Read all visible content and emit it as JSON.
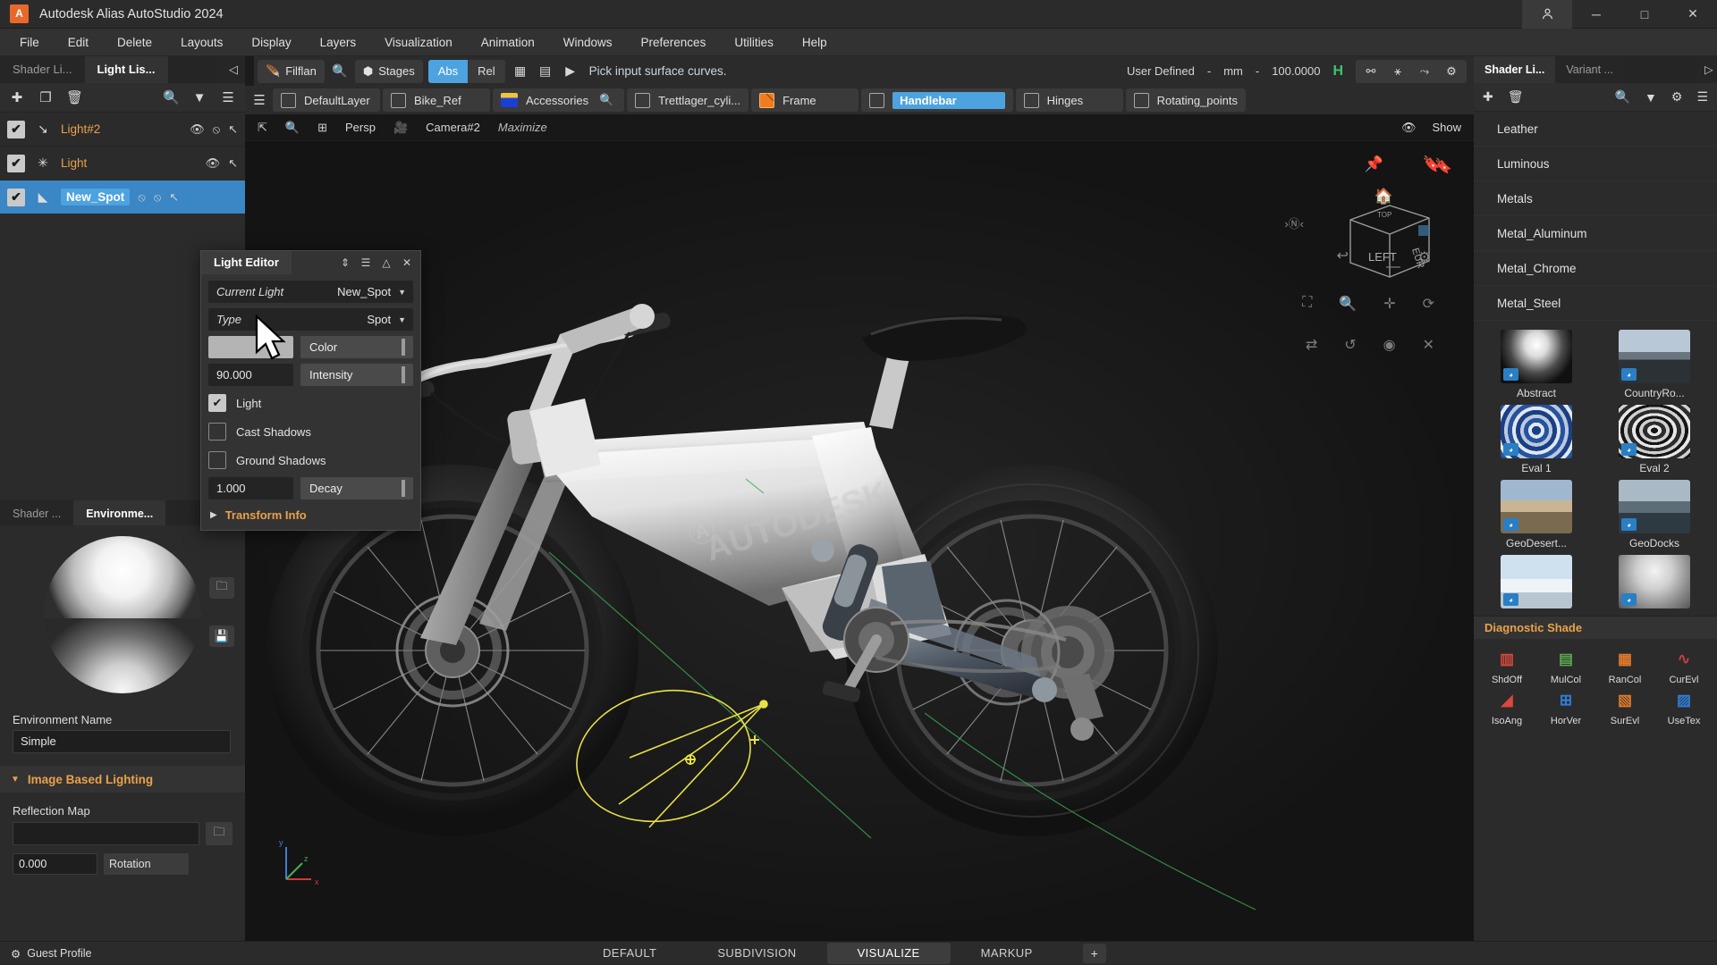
{
  "titlebar": {
    "logo": "A",
    "title": "Autodesk Alias AutoStudio 2024",
    "account_icon": "person-icon",
    "minimize": "─",
    "maximize": "□",
    "close": "✕"
  },
  "menubar": {
    "items": [
      "File",
      "Edit",
      "Delete",
      "Layouts",
      "Display",
      "Layers",
      "Visualization",
      "Animation",
      "Windows",
      "Preferences",
      "Utilities",
      "Help"
    ]
  },
  "left_panel": {
    "tabs": [
      {
        "label": "Shader Li...",
        "active": false
      },
      {
        "label": "Light Lis...",
        "active": true
      }
    ],
    "collapse_icon": "◁",
    "toolbar": [
      "add-icon",
      "duplicate-icon",
      "delete-icon",
      "search-icon",
      "filter-icon",
      "menu-icon"
    ],
    "lights": [
      {
        "name": "Light#2",
        "type_icon": "directional-light-icon",
        "checked": true,
        "selected": false,
        "actions": [
          "eye-icon",
          "eye-off-icon",
          "pointer-icon"
        ]
      },
      {
        "name": "Light",
        "type_icon": "point-light-icon",
        "checked": true,
        "selected": false,
        "actions": [
          "eye-icon",
          "pointer-icon"
        ]
      },
      {
        "name": "New_Spot",
        "type_icon": "spot-light-icon",
        "checked": true,
        "selected": true,
        "actions": [
          "eye-off-icon",
          "eye-off-icon",
          "pointer-icon"
        ]
      }
    ]
  },
  "environment_panel": {
    "tabs": [
      {
        "label": "Shader ...",
        "active": false
      },
      {
        "label": "Environme...",
        "active": true
      }
    ],
    "name_label": "Environment Name",
    "name_value": "Simple",
    "section_title": "Image Based Lighting",
    "reflection_label": "Reflection Map",
    "reflection_value": "",
    "rotation_value": "0.000",
    "rotation_label": "Rotation",
    "browse_icon": "folder-icon",
    "save_icon": "save-icon",
    "open_icon": "folder-open-icon"
  },
  "promptbar": {
    "collapse_icon": "◁",
    "tool_name": "Filflan",
    "search_icon": "search-icon",
    "stages_label": "Stages",
    "stages_icon": "cube-icon",
    "abs_label": "Abs",
    "rel_label": "Rel",
    "abs_active": true,
    "grid_icon": "grid-icon",
    "list_icon": "list-icon",
    "play_icon": "▶",
    "prompt": "Pick input surface curves.",
    "coord_system": "User Defined",
    "dash": "-",
    "unit": "mm",
    "grid_value": "100.0000",
    "h_flag": "H",
    "unit_icons": [
      "construction-plane-icon",
      "snap-grid-icon",
      "snap-curve-icon",
      "settings-gear-icon"
    ]
  },
  "layerbar": {
    "menu_icon": "hamburger-icon",
    "layers": [
      {
        "name": "DefaultLayer",
        "swatch": "empty",
        "highlight": false
      },
      {
        "name": "Bike_Ref",
        "swatch": "empty",
        "highlight": false
      },
      {
        "name": "Accessories",
        "swatch": "folder",
        "highlight": false,
        "search_icon": "layer-search-icon"
      },
      {
        "name": "Trettlager_cyli...",
        "swatch": "empty",
        "highlight": false
      },
      {
        "name": "Frame",
        "swatch": "orange",
        "highlight": false
      },
      {
        "name": "Handlebar",
        "swatch": "empty",
        "highlight": true
      },
      {
        "name": "Hinges",
        "swatch": "empty",
        "highlight": false
      },
      {
        "name": "Rotating_points",
        "swatch": "empty",
        "highlight": false
      }
    ]
  },
  "viewport": {
    "header": {
      "expand_icon": "expand-icon",
      "zoom_icon": "magnifier-icon",
      "layout_icon": "layout-grid-icon",
      "view_name": "Persp",
      "camera_icon": "camera-icon",
      "camera_name": "Camera#2",
      "maximize_label": "Maximize",
      "eye_icon": "eye-icon",
      "show_label": "Show"
    },
    "hud_icons": [
      [
        "pin-icon",
        "bookmark-icon"
      ],
      [
        "home-icon"
      ],
      [
        "compass-n-icon",
        "view-cube-left",
        "settings-gear-icon"
      ],
      [
        "undo-arrow-icon",
        "minus-icon"
      ],
      [
        "zoom-fit-icon",
        "magnifier-icon",
        "pan-icon",
        "orbit-icon"
      ],
      [
        "mirror-icon",
        "rotate-icon",
        "target-icon",
        "close-x-icon"
      ]
    ],
    "navcube_faces": {
      "top": "TOP",
      "front": "LEFT",
      "right": "EUR"
    },
    "axis_labels": {
      "x": "x",
      "y": "y",
      "z": "z"
    },
    "watermark": "AUTODESK"
  },
  "light_editor": {
    "title": "Light Editor",
    "titlebar_icons": [
      "resize-icon",
      "menu-icon",
      "collapse-icon",
      "close-icon"
    ],
    "rows": [
      {
        "key": "Current Light",
        "value": "New_Spot"
      },
      {
        "key": "Type",
        "value": "Spot"
      }
    ],
    "color_swatch": "#b4b4b4",
    "color_label": "Color",
    "intensity_value": "90.000",
    "intensity_label": "Intensity",
    "checkboxes": [
      {
        "label": "Light",
        "checked": true
      },
      {
        "label": "Cast Shadows",
        "checked": false
      },
      {
        "label": "Ground Shadows",
        "checked": false
      }
    ],
    "decay_value": "1.000",
    "decay_label": "Decay",
    "transform_label": "Transform Info",
    "transform_caret": "▶"
  },
  "right_panel": {
    "tabs": [
      {
        "label": "Shader Li...",
        "active": true
      },
      {
        "label": "Variant ...",
        "active": false
      }
    ],
    "arrow_icon": "▷",
    "toolbar": [
      "add-icon",
      "delete-icon",
      "search-icon",
      "filter-icon",
      "settings-icon",
      "menu-icon"
    ],
    "materials": [
      "Leather",
      "Luminous",
      "Metals",
      "Metal_Aluminum",
      "Metal_Chrome",
      "Metal_Steel"
    ],
    "environments": [
      {
        "name": "Abstract",
        "style": "th-abstract"
      },
      {
        "name": "CountryRo...",
        "style": "th-country"
      },
      {
        "name": "Eval 1",
        "style": "th-eval1"
      },
      {
        "name": "Eval 2",
        "style": "th-eval2"
      },
      {
        "name": "GeoDesert...",
        "style": "th-geodes"
      },
      {
        "name": "GeoDocks",
        "style": "th-geodock"
      },
      {
        "name": "",
        "style": "th-snow"
      },
      {
        "name": "",
        "style": "th-studio"
      }
    ],
    "diagnostic": {
      "title": "Diagnostic Shade",
      "items": [
        {
          "label": "ShdOff",
          "glyph": "◫",
          "color": "#d8483c"
        },
        {
          "label": "MulCol",
          "glyph": "▤",
          "color": "#5aa84f"
        },
        {
          "label": "RanCol",
          "glyph": "▦",
          "color": "#e07a2b"
        },
        {
          "label": "CurEvl",
          "glyph": "∿",
          "color": "#c0443a"
        },
        {
          "label": "IsoAng",
          "glyph": "◢",
          "color": "#d8483c"
        },
        {
          "label": "HorVer",
          "glyph": "⊞",
          "color": "#2f7ed8"
        },
        {
          "label": "SurEvl",
          "glyph": "▧",
          "color": "#e07a2b"
        },
        {
          "label": "UseTex",
          "glyph": "▨",
          "color": "#2f7ed8"
        }
      ]
    }
  },
  "statusbar": {
    "profile_icon": "gear-icon",
    "profile_label": "Guest Profile",
    "tabs": [
      {
        "label": "DEFAULT",
        "active": false
      },
      {
        "label": "SUBDIVISION",
        "active": false
      },
      {
        "label": "VISUALIZE",
        "active": true
      },
      {
        "label": "MARKUP",
        "active": false
      }
    ],
    "add_tab": "+"
  },
  "colors": {
    "accent_blue": "#4da2e0",
    "accent_orange": "#e9a24a",
    "brand_orange": "#e8682b",
    "green_flag": "#3fc46a",
    "panel_bg": "#2b2b2b",
    "viewport_bg": "#141414"
  }
}
